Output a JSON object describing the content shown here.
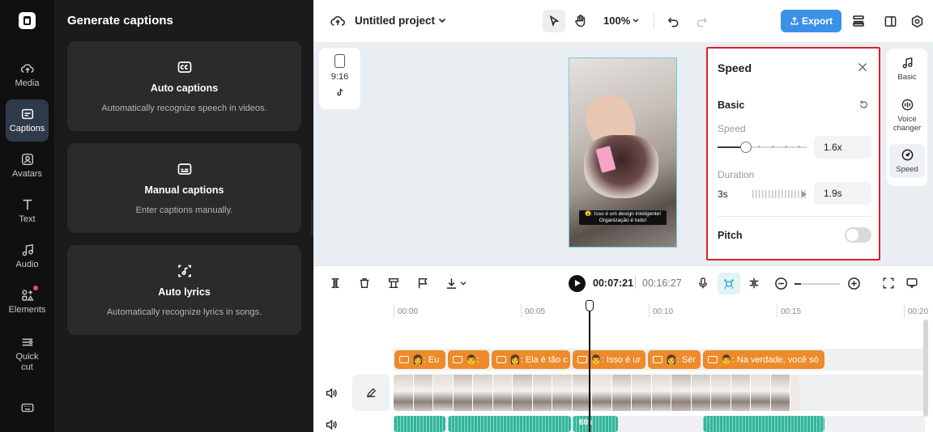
{
  "rail": {
    "items": [
      {
        "label": "Media",
        "icon": "media-icon"
      },
      {
        "label": "Captions",
        "icon": "captions-icon",
        "active": true
      },
      {
        "label": "Avatars",
        "icon": "avatar-icon"
      },
      {
        "label": "Text",
        "icon": "text-icon"
      },
      {
        "label": "Audio",
        "icon": "audio-icon"
      },
      {
        "label": "Elements",
        "icon": "elements-icon",
        "badge": true
      },
      {
        "label": "Quick cut",
        "icon": "quick-cut-icon"
      }
    ]
  },
  "panel": {
    "title": "Generate captions",
    "cards": [
      {
        "title": "Auto captions",
        "desc": "Automatically recognize speech in videos.",
        "icon": "cc-icon"
      },
      {
        "title": "Manual captions",
        "desc": "Enter captions manually.",
        "icon": "subtitle-icon"
      },
      {
        "title": "Auto lyrics",
        "desc": "Automatically recognize lyrics in songs.",
        "icon": "lyrics-icon"
      }
    ]
  },
  "topbar": {
    "project_title": "Untitled project",
    "zoom": "100%",
    "export_label": "Export"
  },
  "canvas": {
    "ratio": "9:16",
    "subtitle_text": "😮: Isso é um design inteligente! Organização é tudo!"
  },
  "speed_panel": {
    "title": "Speed",
    "section": "Basic",
    "speed_label": "Speed",
    "speed_value": "1.6x",
    "speed_fraction": 0.32,
    "duration_label": "Duration",
    "duration_original": "3s",
    "duration_value": "1.9s",
    "pitch_label": "Pitch",
    "pitch_enabled": false
  },
  "right_tabs": [
    {
      "label": "Basic",
      "icon": "music-note-icon"
    },
    {
      "label": "Voice changer",
      "icon": "voice-changer-icon"
    },
    {
      "label": "Speed",
      "icon": "speed-icon",
      "active": true
    }
  ],
  "timeline": {
    "current_time": "00:07:21",
    "total_time": "00:16:27",
    "ruler": [
      "00:00",
      "00:05",
      "00:10",
      "00:15",
      "00:20"
    ],
    "caption_clips": [
      {
        "text": "👩: Eu"
      },
      {
        "text": "👨:"
      },
      {
        "text": "👩: Ela é tão c"
      },
      {
        "text": "👨: Isso é ur"
      },
      {
        "text": "👩: Sér"
      },
      {
        "text": "👨: Na verdade, você só"
      }
    ],
    "audio_label": "60x"
  },
  "colors": {
    "accent": "#3b91e8",
    "caption_clip": "#ee8a2a",
    "audio_clip": "#33b69a",
    "highlight_border": "#d8202b",
    "sidebar_bg": "#101010",
    "panel_bg": "#1b1b1b"
  }
}
